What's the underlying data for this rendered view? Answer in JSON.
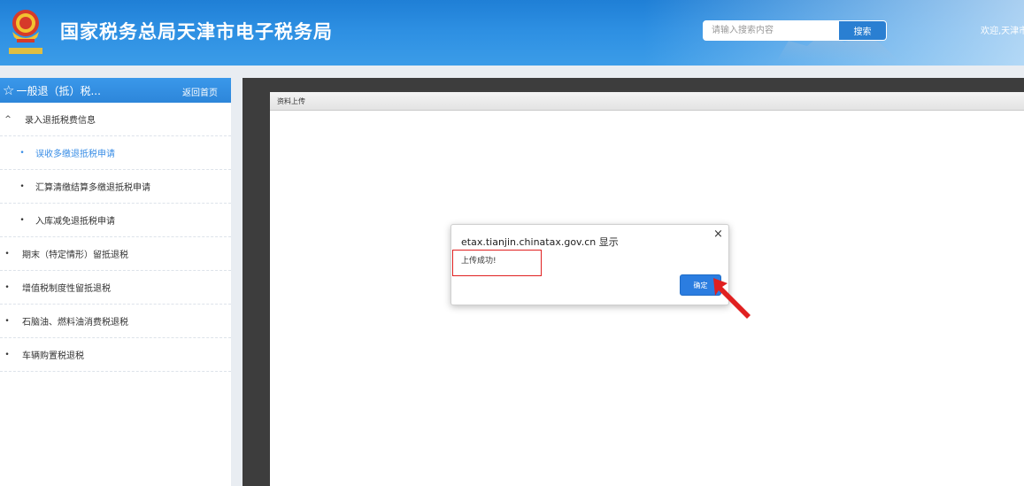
{
  "header": {
    "site_title": "国家税务总局天津市电子税务局",
    "search_placeholder": "请输入搜索内容",
    "search_button": "搜索",
    "welcome_text": "欢迎,天津市"
  },
  "sidebar": {
    "title": "一般退（抵）税...",
    "home_link": "返回首页",
    "items": [
      {
        "label": "录入退抵税费信息",
        "mark": "^"
      },
      {
        "label": "误收多缴退抵税申请",
        "mark": "•"
      },
      {
        "label": "汇算清缴结算多缴退抵税申请",
        "mark": "•"
      },
      {
        "label": "入库减免退抵税申请",
        "mark": "•"
      },
      {
        "label": "期末（特定情形）留抵退税",
        "mark": "•"
      },
      {
        "label": "增值税制度性留抵退税",
        "mark": "•"
      },
      {
        "label": "石脑油、燃料油消费税退税",
        "mark": "•"
      },
      {
        "label": "车辆购置税退税",
        "mark": "•"
      }
    ]
  },
  "content": {
    "panel_title": "资料上传"
  },
  "dialog": {
    "title": "etax.tianjin.chinatax.gov.cn 显示",
    "close": "×",
    "message": "上传成功!",
    "ok_button": "确定"
  },
  "colors": {
    "header_blue": "#2d8fe2",
    "button_blue": "#2b7de0",
    "active_item": "#3a8ee6",
    "annotation_red": "#e02020"
  }
}
